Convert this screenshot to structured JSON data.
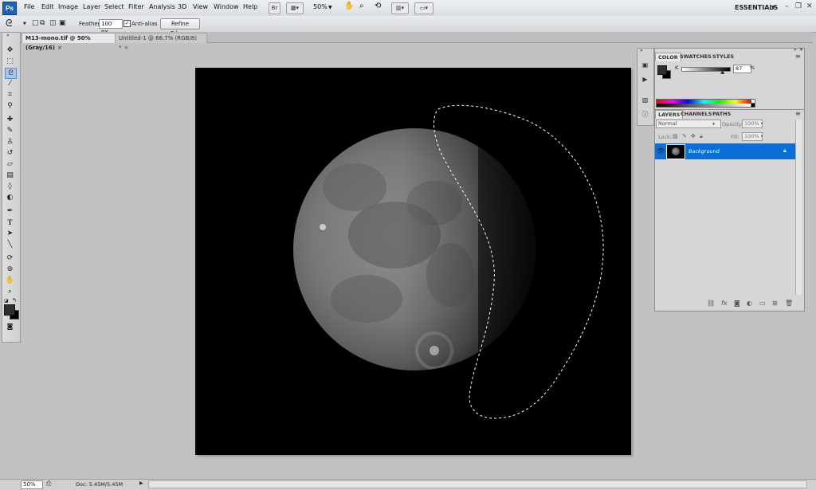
{
  "app": {
    "logo": "Ps",
    "menu": [
      "File",
      "Edit",
      "Image",
      "Layer",
      "Select",
      "Filter",
      "Analysis",
      "3D",
      "View",
      "Window",
      "Help"
    ],
    "bridge_label": "Br",
    "zoom_select": "50%",
    "workspace": "ESSENTIALS",
    "window_controls": {
      "minimize": "–",
      "restore": "❐",
      "close": "✕"
    }
  },
  "options_bar": {
    "feather_label": "Feather:",
    "feather_value": "100 px",
    "antialias_label": "Anti-alias",
    "antialias_checked": true,
    "refine_edge": "Refine Edge..."
  },
  "documents": {
    "tabs": [
      {
        "label": "M13-mono.tif @ 50% (Gray/16)",
        "close": "×",
        "active": true
      },
      {
        "label": "Untitled-1 @ 66.7% (RGB/8) *",
        "close": "×",
        "active": false
      }
    ]
  },
  "toolbox": {
    "tools": [
      "move-tool",
      "marquee-tool",
      "lasso-tool",
      "quick-select-tool",
      "crop-tool",
      "eyedropper-tool",
      "healing-brush-tool",
      "brush-tool",
      "clone-stamp-tool",
      "history-brush-tool",
      "eraser-tool",
      "gradient-tool",
      "blur-tool",
      "dodge-tool",
      "pen-tool",
      "type-tool",
      "path-select-tool",
      "shape-tool",
      "3d-rotate-tool",
      "3d-orbit-tool",
      "hand-tool",
      "zoom-tool"
    ],
    "fg_color": "#2f2f2f",
    "bg_color": "#000000"
  },
  "color_panel": {
    "tabs": [
      "COLOR",
      "SWATCHES",
      "STYLES"
    ],
    "channel_label": "K",
    "channel_value": "87",
    "unit": "%"
  },
  "layers_panel": {
    "tabs": [
      "LAYERS",
      "CHANNELS",
      "PATHS"
    ],
    "blend_mode": "Normal",
    "opacity_label": "Opacity:",
    "opacity_value": "100%",
    "lock_label": "Lock:",
    "fill_label": "Fill:",
    "fill_value": "100%",
    "layers": [
      {
        "name": "Background",
        "visible": true,
        "locked": true,
        "selected": true
      }
    ]
  },
  "status_bar": {
    "zoom": "50%",
    "doc_info": "Doc: 5.45M/5.45M"
  },
  "colors": {
    "accent": "#0b6fd6",
    "canvas_bg": "#000000",
    "workspace_bg": "#c2c2c2"
  }
}
